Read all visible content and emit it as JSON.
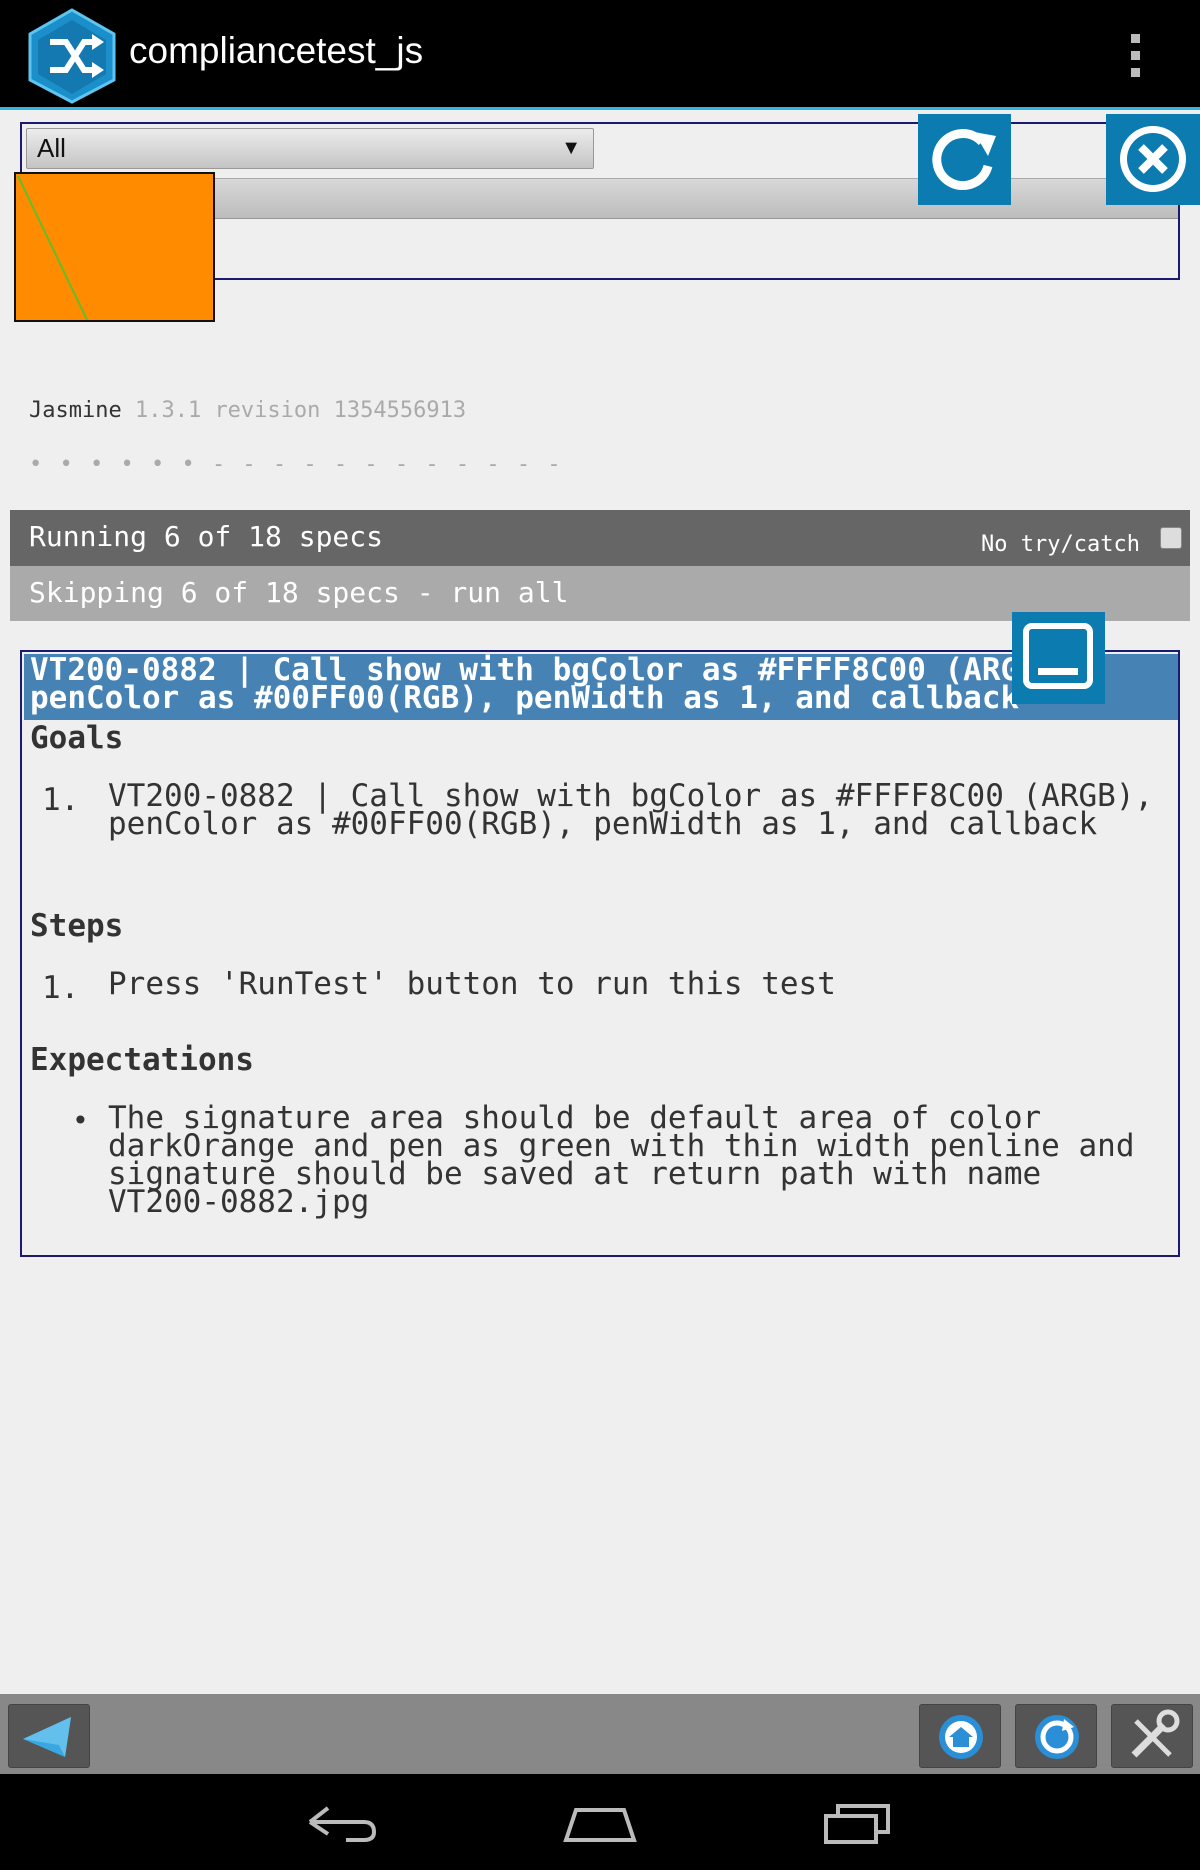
{
  "app": {
    "title": "compliancetest_js"
  },
  "filter": {
    "selected": "All",
    "arrow": "▼"
  },
  "jasmine": {
    "name": "Jasmine",
    "version": "1.3.1 revision 1354556913",
    "progress": "• • • • • • - - - - - - - - - - - -"
  },
  "bars": {
    "running": "Running 6 of 18 specs",
    "trycatch_label": "No try/catch",
    "skipping": "Skipping 6 of 18 specs - run all"
  },
  "spec": {
    "header": "VT200-0882 | Call show with bgColor as #FFFF8C00 (ARGB),\npenColor as #00FF00(RGB), penWidth as 1, and callback",
    "goals_title": "Goals",
    "goals": [
      {
        "num": "1.",
        "text": "VT200-0882 | Call show with bgColor as #FFFF8C00 (ARGB), penColor as #00FF00(RGB), penWidth as 1, and callback"
      }
    ],
    "steps_title": "Steps",
    "steps": [
      {
        "num": "1.",
        "text": "Press 'RunTest' button to run this test"
      }
    ],
    "expectations_title": "Expectations",
    "expectations": [
      {
        "bullet": "•",
        "text": "The signature area should be default area of color darkOrange and pen as green with thin width penline and signature should be saved at return path with name VT200-0882.jpg"
      }
    ]
  },
  "colors": {
    "accent": "#33b5e5",
    "spec_header": "#4682b4",
    "tile": "#0b7bb0",
    "signature_bg": "#ff8c00",
    "pen": "#00ff00"
  }
}
